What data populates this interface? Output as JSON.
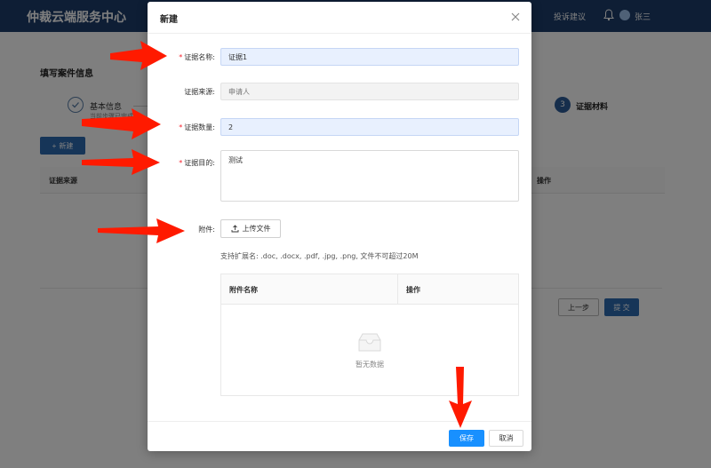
{
  "app": {
    "brand": "仲裁云端服务中心",
    "header_link": "投诉建议",
    "user_name": "张三"
  },
  "background": {
    "page_title": "填写案件信息",
    "steps": [
      {
        "label": "基本信息",
        "sub": "当前步骤已完成",
        "status": "done"
      },
      {
        "number": "3",
        "label": "证据材料",
        "status": "active"
      }
    ],
    "new_button": "新建",
    "table_col_source": "证据来源",
    "table_col_ops": "操作",
    "prev_button": "上一步",
    "submit_button": "提 交"
  },
  "modal": {
    "title": "新建",
    "fields": {
      "name": {
        "label": "证据名称:",
        "required": true,
        "value": "证据1"
      },
      "source": {
        "label": "证据来源:",
        "required": false,
        "placeholder": "申请人"
      },
      "count": {
        "label": "证据数量:",
        "required": true,
        "value": "2"
      },
      "purpose": {
        "label": "证据目的:",
        "required": true,
        "value": "测试"
      },
      "attachment": {
        "label": "附件:",
        "required": false
      }
    },
    "upload_button": "上传文件",
    "upload_hint": "支持扩展名: .doc, .docx, .pdf, .jpg, .png, 文件不可超过20M",
    "attachment_table": {
      "columns": [
        "附件名称",
        "操作"
      ],
      "empty_text": "暂无数据"
    },
    "save_button": "保存",
    "cancel_button": "取消"
  },
  "colors": {
    "header_bg": "#1c3d6b",
    "primary": "#1890ff",
    "required_mark": "#f5222d",
    "annotation_arrow": "#ff1a00"
  },
  "annotation_icons": [
    "arrow-icon"
  ]
}
